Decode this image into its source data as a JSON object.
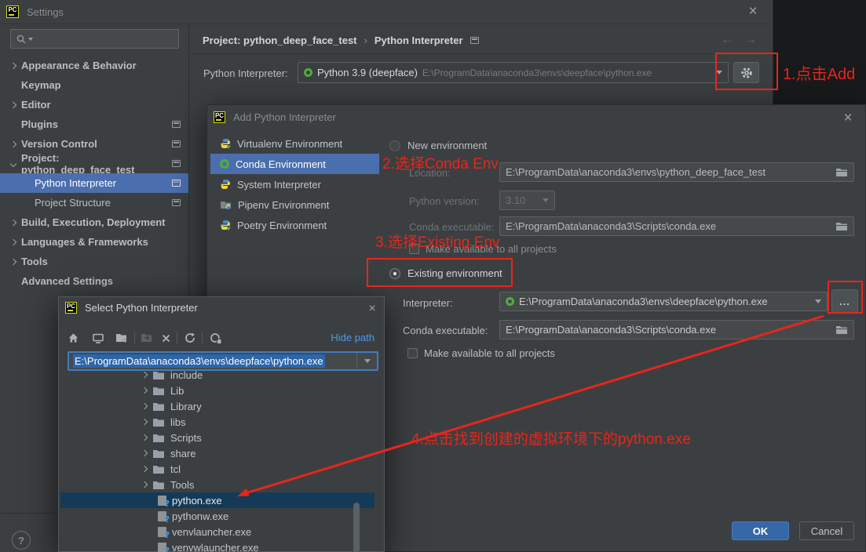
{
  "window": {
    "title": "Settings",
    "close_glyph": "×"
  },
  "sidebar": {
    "items": [
      {
        "label": "Appearance & Behavior"
      },
      {
        "label": "Keymap"
      },
      {
        "label": "Editor"
      },
      {
        "label": "Plugins"
      },
      {
        "label": "Version Control"
      },
      {
        "label": "Project: python_deep_face_test"
      },
      {
        "label": "Python Interpreter"
      },
      {
        "label": "Project Structure"
      },
      {
        "label": "Build, Execution, Deployment"
      },
      {
        "label": "Languages & Frameworks"
      },
      {
        "label": "Tools"
      },
      {
        "label": "Advanced Settings"
      }
    ]
  },
  "breadcrumb": {
    "project": "Project: python_deep_face_test",
    "separator": "›",
    "page": "Python Interpreter"
  },
  "interpreter_row": {
    "label": "Python Interpreter:",
    "value_name": "Python 3.9 (deepface)",
    "value_path": "E:\\ProgramData\\anaconda3\\envs\\deepface\\python.exe"
  },
  "help": {
    "label": "?"
  },
  "add_dialog": {
    "title": "Add Python Interpreter",
    "env_list": [
      {
        "label": "Virtualenv Environment"
      },
      {
        "label": "Conda Environment"
      },
      {
        "label": "System Interpreter"
      },
      {
        "label": "Pipenv Environment"
      },
      {
        "label": "Poetry Environment"
      }
    ],
    "new_env": {
      "radio_label": "New environment",
      "location_label": "Location:",
      "location_value": "E:\\ProgramData\\anaconda3\\envs\\python_deep_face_test",
      "python_version_label": "Python version:",
      "python_version_value": "3.10",
      "conda_executable_label": "Conda executable:",
      "conda_executable_value": "E:\\ProgramData\\anaconda3\\Scripts\\conda.exe",
      "make_available_label": "Make available to all projects"
    },
    "existing_env": {
      "radio_label": "Existing environment",
      "interpreter_label": "Interpreter:",
      "interpreter_value": "E:\\ProgramData\\anaconda3\\envs\\deepface\\python.exe",
      "browse_label": "...",
      "conda_executable_label": "Conda executable:",
      "conda_executable_value": "E:\\ProgramData\\anaconda3\\Scripts\\conda.exe",
      "make_available_label": "Make available to all projects"
    },
    "buttons": {
      "ok": "OK",
      "cancel": "Cancel"
    }
  },
  "select_dialog": {
    "title": "Select Python Interpreter",
    "hide_path_label": "Hide path",
    "path_value": "E:\\ProgramData\\anaconda3\\envs\\deepface\\python.exe",
    "toolbar_icons": [
      "home",
      "desktop",
      "new-folder",
      "move-to",
      "delete",
      "refresh",
      "show-hidden-files"
    ],
    "tree": [
      {
        "name": "include",
        "type": "folder"
      },
      {
        "name": "Lib",
        "type": "folder"
      },
      {
        "name": "Library",
        "type": "folder"
      },
      {
        "name": "libs",
        "type": "folder"
      },
      {
        "name": "Scripts",
        "type": "folder"
      },
      {
        "name": "share",
        "type": "folder"
      },
      {
        "name": "tcl",
        "type": "folder"
      },
      {
        "name": "Tools",
        "type": "folder"
      },
      {
        "name": "python.exe",
        "type": "executable",
        "selected": true
      },
      {
        "name": "pythonw.exe",
        "type": "executable"
      },
      {
        "name": "venvlauncher.exe",
        "type": "executable"
      },
      {
        "name": "venvwlauncher.exe",
        "type": "executable"
      }
    ]
  },
  "annotations": {
    "step1": "1.点击Add",
    "step2": "2.选择Conda Env",
    "step3": "3.选择Existing Env",
    "step4": "4.点击找到创建的虚拟环境下的python.exe",
    "color": "#e8251c",
    "selection_blue": "#4b6eaf",
    "tree_selection": "#143a57"
  }
}
